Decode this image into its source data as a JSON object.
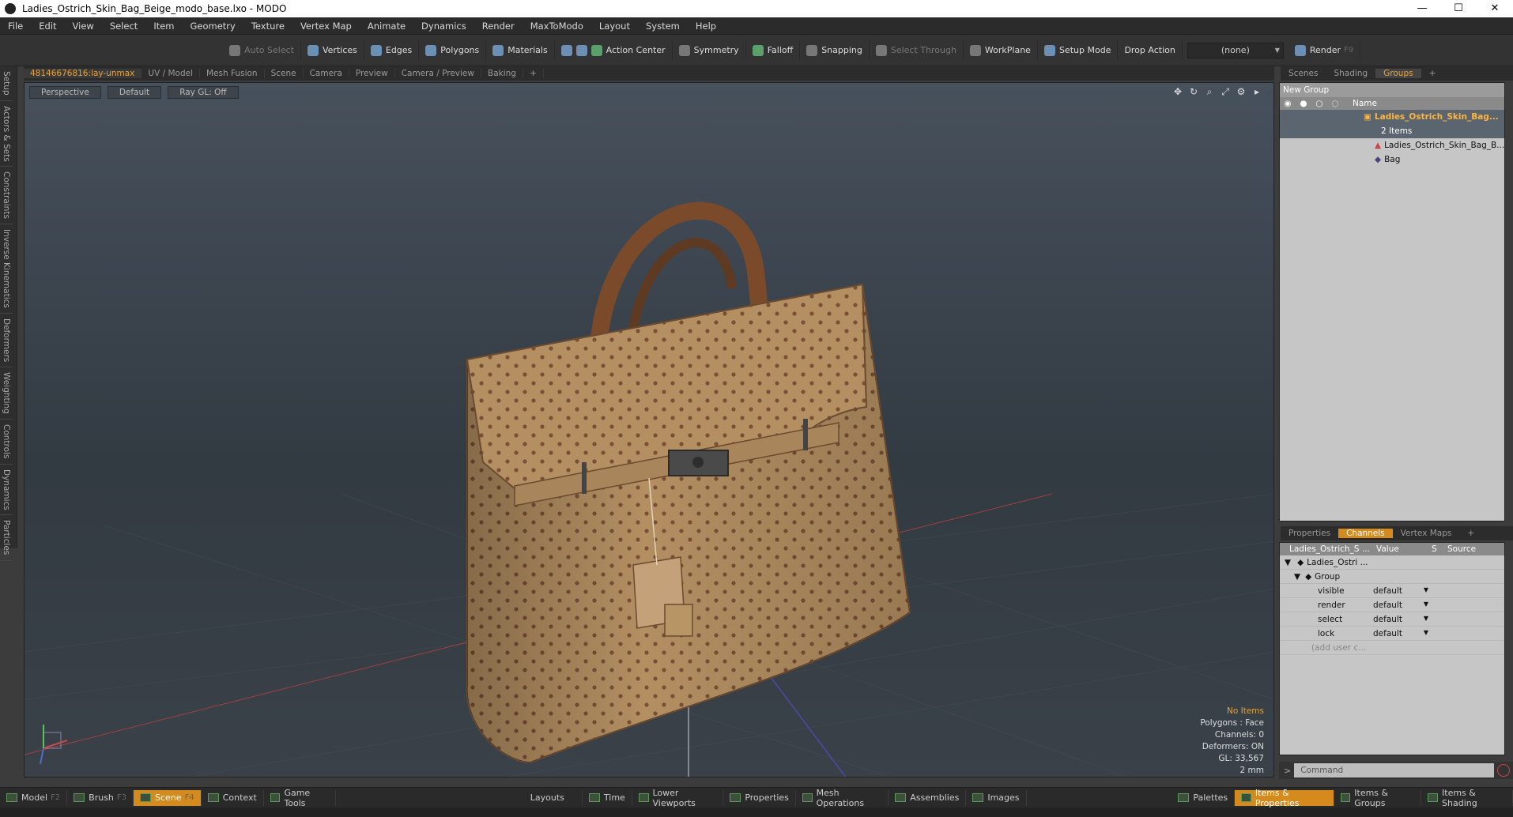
{
  "window": {
    "title": "Ladies_Ostrich_Skin_Bag_Beige_modo_base.lxo - MODO"
  },
  "menu": [
    "File",
    "Edit",
    "View",
    "Select",
    "Item",
    "Geometry",
    "Texture",
    "Vertex Map",
    "Animate",
    "Dynamics",
    "Render",
    "MaxToModo",
    "Layout",
    "System",
    "Help"
  ],
  "toolbar": {
    "auto_select": "Auto Select",
    "vertices": "Vertices",
    "edges": "Edges",
    "polygons": "Polygons",
    "materials": "Materials",
    "action_center": "Action Center",
    "symmetry": "Symmetry",
    "falloff": "Falloff",
    "snapping": "Snapping",
    "select_through": "Select Through",
    "workplane": "WorkPlane",
    "setup_mode": "Setup Mode",
    "drop_action": "Drop Action",
    "drop_value": "(none)",
    "render": "Render",
    "render_key": "F9"
  },
  "left_tabs": [
    "Setup",
    "Actors & Sets",
    "Constraints",
    "Inverse Kinematics",
    "Deformers",
    "Weighting",
    "Controls",
    "Dynamics",
    "Particles"
  ],
  "viewport_tabs": [
    "48146676816:lay-unmax",
    "UV / Model",
    "Mesh Fusion",
    "Scene",
    "Camera",
    "Preview",
    "Camera / Preview",
    "Baking",
    "+"
  ],
  "viewport": {
    "perspective": "Perspective",
    "shading": "Default",
    "raygl": "Ray GL: Off",
    "stats": {
      "items": "No Items",
      "polygons": "Polygons : Face",
      "channels": "Channels: 0",
      "deformers": "Deformers: ON",
      "gl": "GL: 33,567",
      "size": "2 mm"
    }
  },
  "right_tabs": [
    "Scenes",
    "Shading",
    "Groups",
    "+"
  ],
  "groups": {
    "new_group": "New Group",
    "name_col": "Name",
    "root": "Ladies_Ostrich_Skin_Bag...",
    "root_count": "2 Items",
    "child_mesh": "Ladies_Ostrich_Skin_Bag_B...",
    "child_group": "Bag"
  },
  "channel_tabs": [
    "Properties",
    "Channels",
    "Vertex Maps",
    "+"
  ],
  "channels": {
    "header_name": "Ladies_Ostrich_S ...",
    "header_value": "Value",
    "header_s": "S",
    "header_source": "Source",
    "root": "Ladies_Ostri ...",
    "group": "Group",
    "rows": [
      {
        "name": "visible",
        "value": "default"
      },
      {
        "name": "render",
        "value": "default"
      },
      {
        "name": "select",
        "value": "default"
      },
      {
        "name": "lock",
        "value": "default"
      }
    ],
    "add_user": "(add user c..."
  },
  "command": {
    "prompt": ">",
    "placeholder": "Command"
  },
  "statusbar": {
    "left": [
      {
        "label": "Model",
        "key": "F2"
      },
      {
        "label": "Brush",
        "key": "F3"
      },
      {
        "label": "Scene",
        "key": "F4"
      },
      {
        "label": "Context",
        "key": ""
      },
      {
        "label": "Game Tools",
        "key": ""
      }
    ],
    "middle": [
      "Layouts",
      "Time",
      "Lower Viewports",
      "Properties",
      "Mesh Operations",
      "Assemblies",
      "Images"
    ],
    "right": [
      "Palettes",
      "Items & Properties",
      "Items & Groups",
      "Items & Shading"
    ]
  },
  "colors": {
    "accent": "#d58a1e",
    "highlight_text": "#e8a23a",
    "bag_main": "#b38f62",
    "bag_handle": "#7a4a2a"
  }
}
